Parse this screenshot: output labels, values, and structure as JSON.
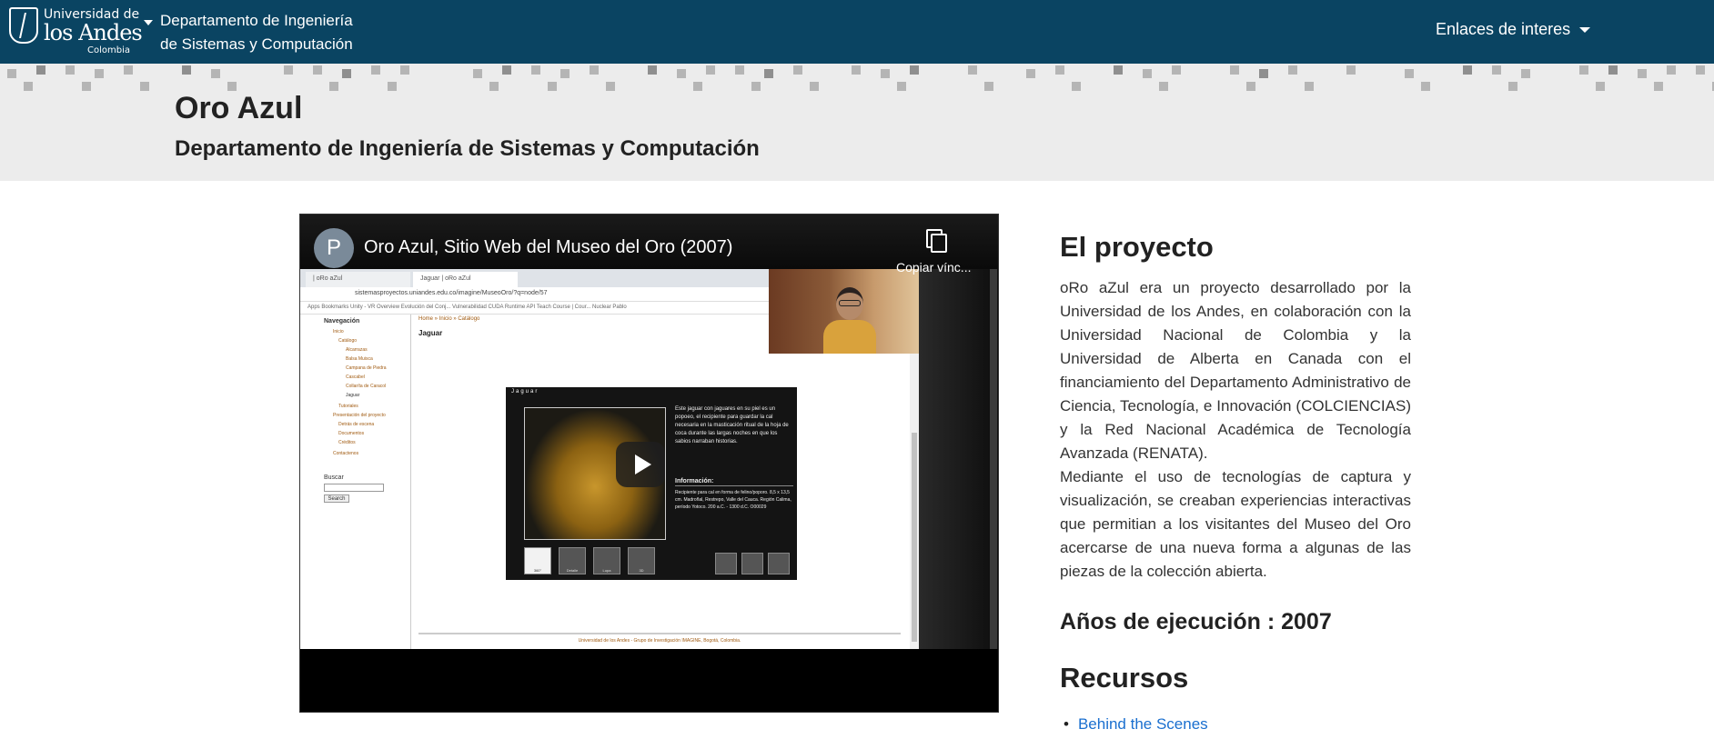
{
  "navbar": {
    "logo_top": "Universidad de",
    "logo_main": "los Andes",
    "logo_sub": "Colombia",
    "dept_line1": "Departamento de Ingeniería",
    "dept_line2": "de Sistemas y Computación",
    "links_menu": "Enlaces de interes"
  },
  "header": {
    "title": "Oro Azul",
    "subtitle": "Departamento de Ingeniería de Sistemas y Computación"
  },
  "video": {
    "avatar_letter": "P",
    "title": "Oro Azul, Sitio Web del Museo del Oro (2007)",
    "copy_label": "Copiar vínc...",
    "inner": {
      "tab1": "| oRo aZul",
      "tab2": "Jaguar | oRo aZul",
      "url": "sistemasproyectos.uniandes.edu.co/imagine/MuseoOro/?q=node/57",
      "bookmarks": "Apps   Bookmarks   Unity - VR Overview   Evolución del Conj...   Vulnerabilidad   CUDA Runtime API   Teach Course | Cour...   Nuclear   Pablo",
      "sidebar_heading": "Navegación",
      "sidebar_items": [
        "Inicio",
        "Catálogo",
        "Alcarrazas",
        "Balsa Muisca",
        "Campana de Piedra",
        "Cascabel",
        "Collar/ta de Caracol",
        "Jaguar",
        "Tutoriales",
        "Presentación del proyecto",
        "Detrás de escena",
        "Documentos",
        "Créditos",
        "Contactenos"
      ],
      "search_label": "Buscar",
      "search_button": "Search",
      "breadcrumb": "Home » Inicio » Catálogo",
      "heading": "Jaguar",
      "flash_title": "Jaguar",
      "flash_text": "Este jaguar con jaguares en su piel es un popoeo, el recipiente para guardar la cal necesaria en la masticación ritual de la hoja de coca durante las largas noches en que los sabios narraban historias.",
      "flash_info_title": "Información:",
      "flash_info": "Recipiente para cal en forma de felino/poporo. 8,5 x 13,5 cm. Madroñal, Restrepo, Valle del Cauca. Región Calima, período Yotoco. 200 a.C. - 1300 d.C. O00029",
      "tools": [
        "360°",
        "Detalle",
        "Lupa",
        "3D"
      ],
      "footer": "Universidad de los Andes - Grupo de Investigación IMAGINE, Bogotá, Colombia."
    }
  },
  "project": {
    "title": "El proyecto",
    "paragraph1": "oRo aZul era un proyecto desarrollado por la Universidad de los Andes, en colaboración con la Universidad Nacional de Colombia y la Universidad de Alberta en Canada con el financiamiento del Departamento Administrativo de Ciencia, Tecnología, e Innovación (COLCIENCIAS) y la Red Nacional Académica de Tecnología Avanzada (RENATA).",
    "paragraph2": "Mediante el uso de tecnologías de captura y visualización, se creaban experiencias interactivas que permitian a los visitantes del Museo del Oro acercarse de una nueva forma a algunas de las piezas de la colección abierta.",
    "years": "Años de ejecución : 2007",
    "resources_title": "Recursos",
    "resources": [
      "Behind the Scenes"
    ]
  },
  "colors": {
    "navbar": "#0a4462",
    "header_band": "#ececec",
    "link": "#1a6fcf"
  }
}
